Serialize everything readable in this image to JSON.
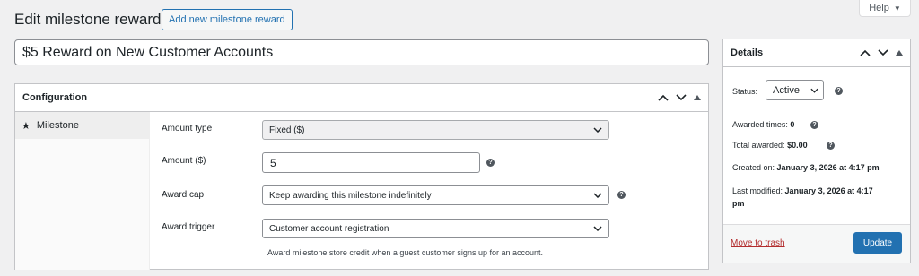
{
  "help_tab": {
    "label": "Help",
    "caret": "▼"
  },
  "page": {
    "title": "Edit milestone reward",
    "add_new_label": "Add new milestone reward",
    "reward_title": "$5 Reward on New Customer Accounts"
  },
  "configuration": {
    "heading": "Configuration",
    "tabs": [
      {
        "label": "Milestone",
        "icon": "star-icon"
      }
    ],
    "fields": {
      "amount_type": {
        "label": "Amount type",
        "value": "Fixed ($)"
      },
      "amount": {
        "label": "Amount ($)",
        "value": "5"
      },
      "award_cap": {
        "label": "Award cap",
        "value": "Keep awarding this milestone indefinitely"
      },
      "award_trigger": {
        "label": "Award trigger",
        "value": "Customer account registration",
        "description": "Award milestone store credit when a guest customer signs up for an account."
      }
    }
  },
  "details": {
    "heading": "Details",
    "status_label": "Status:",
    "status_value": "Active",
    "awarded_times_label": "Awarded times:",
    "awarded_times_value": "0",
    "total_awarded_label": "Total awarded:",
    "total_awarded_value": "$0.00",
    "created_on_label": "Created on:",
    "created_on_value": "January 3, 2026 at 4:17 pm",
    "last_modified_label": "Last modified:",
    "last_modified_value_line1": "January 3, 2026 at 4:17",
    "last_modified_value_line2": "pm",
    "trash_label": "Move to trash",
    "update_label": "Update"
  },
  "colors": {
    "accent": "#2271b1",
    "danger": "#b32d2e",
    "background": "#f0f0f1"
  }
}
